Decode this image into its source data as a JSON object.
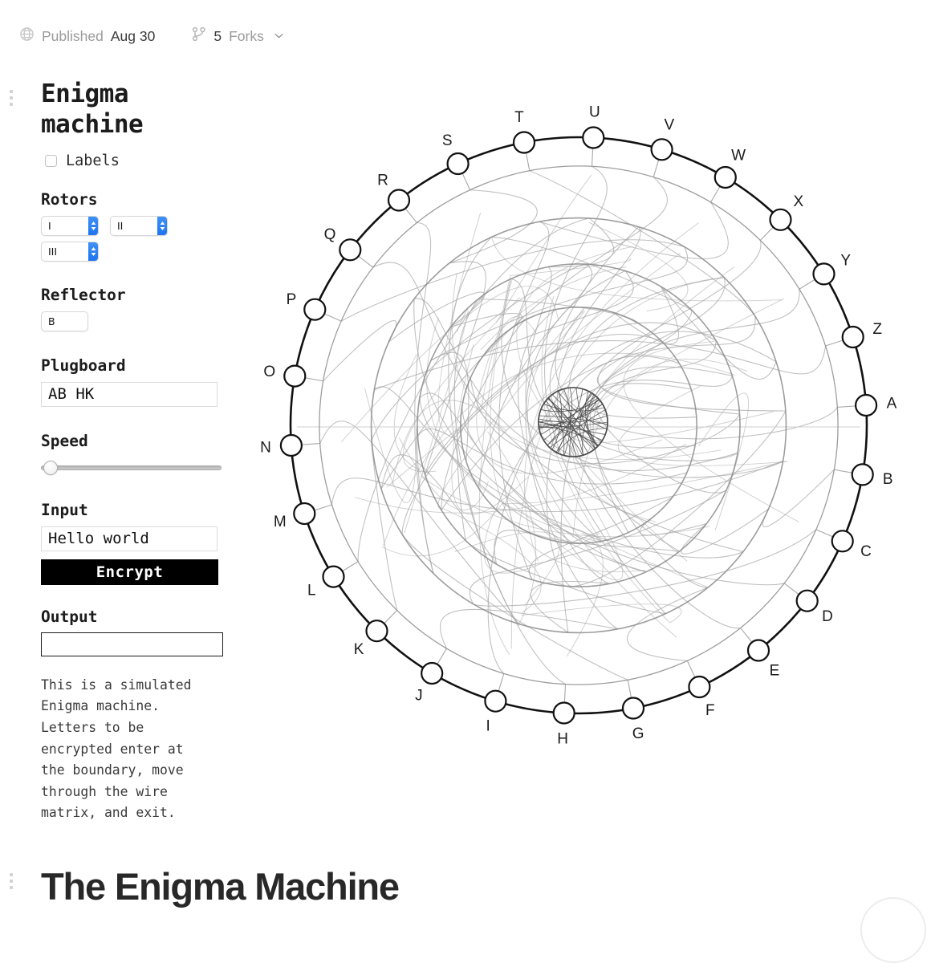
{
  "meta": {
    "published_icon": "globe-icon",
    "published_label": "Published",
    "published_date": "Aug 30",
    "forks_icon": "fork-icon",
    "forks_count": "5",
    "forks_label": "Forks",
    "forks_caret_icon": "chevron-down-icon"
  },
  "sidebar": {
    "title": "Enigma\nmachine",
    "labels_checkbox": {
      "label": "Labels",
      "checked": false
    },
    "rotors": {
      "title": "Rotors",
      "selects": [
        {
          "name": "rotor-1",
          "value": "I"
        },
        {
          "name": "rotor-2",
          "value": "II"
        },
        {
          "name": "rotor-3",
          "value": "III"
        }
      ]
    },
    "reflector": {
      "title": "Reflector",
      "value": "B"
    },
    "plugboard": {
      "title": "Plugboard",
      "value": "AB HK",
      "placeholder": ""
    },
    "speed": {
      "title": "Speed",
      "value": 0,
      "min": 0,
      "max": 100
    },
    "input": {
      "title": "Input",
      "value": "Hello world",
      "placeholder": ""
    },
    "encrypt_button": "Encrypt",
    "output": {
      "title": "Output",
      "value": "",
      "placeholder": ""
    },
    "description": "This is a simulated Enigma machine. Letters to be encrypted enter at the boundary, move through the wire matrix, and exit."
  },
  "diagram": {
    "name": "enigma-wire-matrix",
    "letters": [
      "A",
      "B",
      "C",
      "D",
      "E",
      "F",
      "G",
      "H",
      "I",
      "J",
      "K",
      "L",
      "M",
      "N",
      "O",
      "P",
      "Q",
      "R",
      "S",
      "T",
      "U",
      "V",
      "W",
      "X",
      "Y",
      "Z"
    ],
    "colors": {
      "ring": "#111111",
      "node_fill": "#ffffff",
      "node_stroke": "#111111",
      "wire": "#a8a8a8",
      "rotor_ring": "#8c8c8c",
      "reflector": "#4a4a4a"
    },
    "rotor_rings": [
      0.9,
      0.72,
      0.56,
      0.41
    ],
    "reflector_radius": 0.12
  },
  "bottom": {
    "heading": "The Enigma Machine"
  }
}
